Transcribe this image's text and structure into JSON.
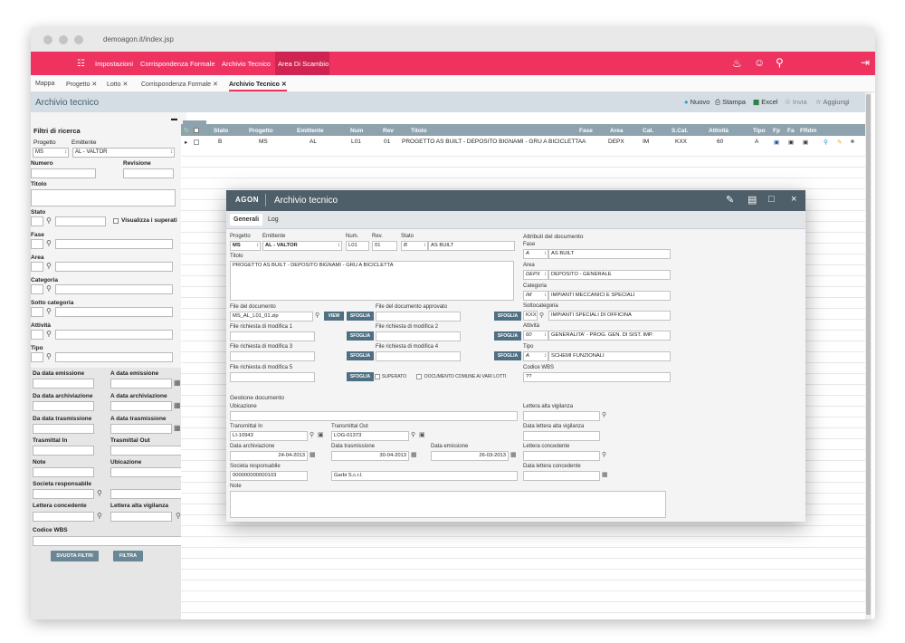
{
  "browser": {
    "url": "demoagon.it/index.jsp"
  },
  "nav": {
    "items": [
      "Impostazioni",
      "Corrispondenza Formale",
      "Archivio Tecnico",
      "Area Di Scambio"
    ]
  },
  "tabs": [
    "Mappa",
    "Progetto",
    "Lotto",
    "Corrispondenza Formale",
    "Archivio Tecnico"
  ],
  "page": {
    "title": "Archivio tecnico",
    "actions": {
      "nuovo": "Nuovo",
      "stampa": "Stampa",
      "excel": "Excel",
      "invia": "Invia",
      "aggiungi": "Aggiungi"
    }
  },
  "filters": {
    "title": "Filtri di ricerca",
    "progetto_label": "Progetto",
    "progetto_value": "MS",
    "emittente_label": "Emittente",
    "emittente_value": "AL - VALTOR",
    "numero_label": "Numero",
    "revisione_label": "Revisione",
    "titolo_label": "Titolo",
    "stato_label": "Stato",
    "visualizza_label": "Visualizza i superati",
    "fase_label": "Fase",
    "area_label": "Area",
    "categoria_label": "Categoria",
    "sottocategoria_label": "Sotto categoria",
    "attivita_label": "Attività",
    "tipo_label": "Tipo",
    "da_emissione": "Da data emissione",
    "a_emissione": "A data emissione",
    "da_archiviazione": "Da data archiviazione",
    "a_archiviazione": "A data archiviazione",
    "da_trasmissione": "Da data trasmissione",
    "a_trasmissione": "A data trasmissione",
    "trasmittal_in": "Trasmittal In",
    "trasmittal_out": "Trasmittal Out",
    "note": "Note",
    "ubicazione": "Ubicazione",
    "societa": "Societa responsabile",
    "lettera_concedente": "Lettera concedente",
    "lettera_alta": "Lettera alta vigilanza",
    "codice_wbs": "Codice WBS",
    "svuota": "SVUOTA FILTRI",
    "filtra": "FILTRA"
  },
  "table": {
    "headers": [
      "Stato",
      "Progetto",
      "Emittente",
      "Num",
      "Rev",
      "Titolo",
      "Fase",
      "Area",
      "Cat.",
      "S.Cat.",
      "Attività",
      "Tipo",
      "Fp",
      "Fa",
      "FRdm"
    ],
    "row": [
      "B",
      "MS",
      "AL",
      "L01",
      "01",
      "PROGETTO AS BUILT - DEPOSITO BIGNAMI - GRU A BICICLETTA",
      "A",
      "DEPX",
      "IM",
      "KXX",
      "60",
      "A"
    ]
  },
  "modal": {
    "logo": "AGON",
    "title": "Archivio tecnico",
    "tab_generali": "Generali",
    "tab_log": "Log",
    "progetto_label": "Progetto",
    "progetto_value": "MS",
    "emittente_label": "Emittente",
    "emittente_value": "AL - VALTOR",
    "num_label": "Num.",
    "num_value": "L01",
    "rev_label": "Rev.",
    "rev_value": "01",
    "stato_label": "Stato",
    "stato_code": "B",
    "stato_text": "AS BUILT",
    "titolo_label": "Titolo",
    "titolo_value": "PROGETTO AS BUILT - DEPOSITO BIGNAMI - GRU A BICICLETTA",
    "file_doc_label": "File del documento",
    "file_doc_value": "MS_AL_L01_01.zip",
    "file_approvato_label": "File del documento approvato",
    "mod1": "File richiesta di modifica 1",
    "mod2": "File richiesta di modifica 2",
    "mod3": "File richiesta di modifica 3",
    "mod4": "File richiesta di modifica 4",
    "mod5": "File richiesta di modifica 5",
    "view": "VIEW",
    "sfoglia": "SFOGLIA",
    "superato": "SUPERATO",
    "comune": "DOCUMENTO COMUNE AI VARI LOTTI",
    "attributi": "Attributi del documento",
    "fase_label": "Fase",
    "fase_code": "A",
    "fase_text": "AS BUILT",
    "area_label": "Area",
    "area_code": "DEPX",
    "area_text": "DEPOSITO - GENERALE",
    "categoria_label": "Categoria",
    "categoria_code": "IM",
    "categoria_text": "IMPIANTI MECCANICI E SPECIALI",
    "sottocat_label": "Sottocategoria",
    "sottocat_code": "KXX",
    "sottocat_text": "IMPIANTI SPECIALI DI OFFICINA",
    "attivita_label": "Attività",
    "attivita_code": "60",
    "attivita_text": "GENERALITA' - PROG. GEN. DI SIST. IMP.",
    "tipo_label": "Tipo",
    "tipo_code": "A",
    "tipo_text": "SCHEMI FUNZIONALI",
    "wbs_label": "Codice WBS",
    "wbs_value": "??",
    "gestione": "Gestione documento",
    "ubicazione_label": "Ubicazione",
    "lettera_alta_label": "Lettera alta vigilanza",
    "data_lettera_alta_label": "Data lettera alta vigilanza",
    "trasmittal_in_label": "Transmittal In",
    "trasmittal_in_value": "LI-10943",
    "trasmittal_out_label": "Transmittal Out",
    "trasmittal_out_value": "LOG-01373",
    "data_arch_label": "Data archiviazione",
    "data_arch_value": "24-04-2013",
    "data_tras_label": "Data trasmissione",
    "data_tras_value": "30-04-2013",
    "data_emis_label": "Data emissione",
    "data_emis_value": "26-03-2013",
    "lettera_conc_label": "Lettera concedente",
    "data_lettera_conc_label": "Data lettera concedente",
    "societa_label": "Societa responsabile",
    "societa_code": "000000000000103",
    "societa_name": "Garbi S.c.r.l.",
    "note_label": "Note"
  },
  "colors": {
    "accent": "#ee3360",
    "header": "#4f5f6a",
    "grid_header": "#8fa3ae"
  }
}
